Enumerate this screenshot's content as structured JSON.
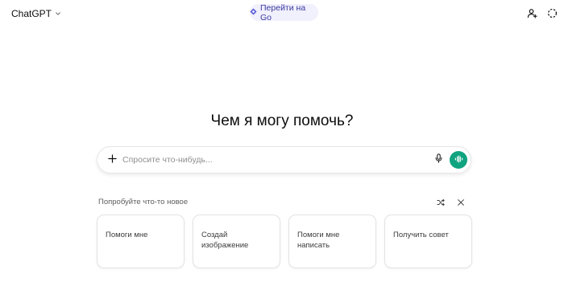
{
  "header": {
    "model_name": "ChatGPT",
    "upgrade_label": "Перейти на Go",
    "icons": {
      "model_dropdown": "chevron-down-icon",
      "upgrade": "diamond-icon",
      "profile": "add-person-icon",
      "temporary_chat": "dashed-circle-icon"
    }
  },
  "main": {
    "heading": "Чем я могу помочь?"
  },
  "composer": {
    "placeholder": "Спросите что-нибудь...",
    "value": "",
    "icons": {
      "attach": "plus-icon",
      "dictate": "microphone-icon",
      "voice": "voice-waveform-icon"
    },
    "accent_color": "#10a37f"
  },
  "suggestions": {
    "title": "Попробуйте что-то новое",
    "icons": {
      "shuffle": "shuffle-icon",
      "close": "close-icon"
    },
    "cards": [
      {
        "label": "Помоги мне"
      },
      {
        "label": "Создай\nизображение"
      },
      {
        "label": "Помоги мне\nнаписать"
      },
      {
        "label": "Получить совет"
      }
    ]
  }
}
